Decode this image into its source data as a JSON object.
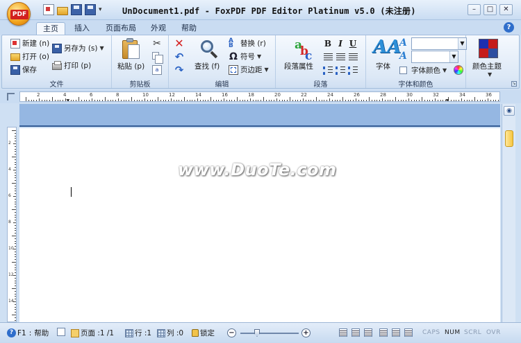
{
  "titlebar": {
    "logo_text": "PDF",
    "title": "UnDocument1.pdf - FoxPDF PDF Editor Platinum v5.0 (未注册)",
    "quick_access_menu": "▾",
    "minimize": "–",
    "restore": "□",
    "close": "✕"
  },
  "tabs": [
    {
      "label": "主页",
      "active": true
    },
    {
      "label": "插入"
    },
    {
      "label": "页面布局"
    },
    {
      "label": "外观"
    },
    {
      "label": "帮助"
    }
  ],
  "help_button": "?",
  "ribbon": {
    "file": {
      "label": "文件",
      "new": "新建 (n)",
      "open": "打开 (o)",
      "save": "保存",
      "save_as": "另存为 (s)",
      "print": "打印 (p)"
    },
    "clipboard": {
      "label": "剪贴板",
      "paste": "粘贴 (p)"
    },
    "edit": {
      "label": "编辑",
      "find": "查找 (f)",
      "replace": "替换 (r)",
      "symbol": "符号",
      "margins": "页边距"
    },
    "paragraph": {
      "label": "段落",
      "paragraph_props": "段落属性",
      "bold": "B",
      "italic": "I",
      "underline": "U"
    },
    "font": {
      "label": "字体和颜色",
      "font": "字体",
      "font_color": "字体颜色",
      "font_name": "",
      "font_size": ""
    },
    "theme": {
      "label": "颜色主题",
      "colors": [
        "#1c2fb0",
        "#c41b1b",
        "#c41b1b",
        "#2e4ea0"
      ]
    }
  },
  "document": {
    "watermark": "www.DuoTe.com"
  },
  "ruler": {
    "h_numbers": [
      "2",
      "4",
      "6",
      "8",
      "10",
      "12",
      "14",
      "16",
      "18",
      "20",
      "22",
      "24",
      "26",
      "28",
      "30",
      "32",
      "34",
      "36"
    ],
    "v_numbers": [
      "2",
      "4",
      "6",
      "8",
      "10",
      "12",
      "14"
    ]
  },
  "statusbar": {
    "help_key": "F1",
    "help": "帮助",
    "page": "页面 :1 /1",
    "row": "行 :1",
    "col": "列 :0",
    "lock": "锁定",
    "zoom_out": "−",
    "zoom_in": "+",
    "caps": "CAPS",
    "num": "NUM",
    "scrl": "SCRL",
    "ovr": "OVR"
  },
  "colors": {
    "accent": "#2f6ecb",
    "page_header": "#95b7e2"
  }
}
